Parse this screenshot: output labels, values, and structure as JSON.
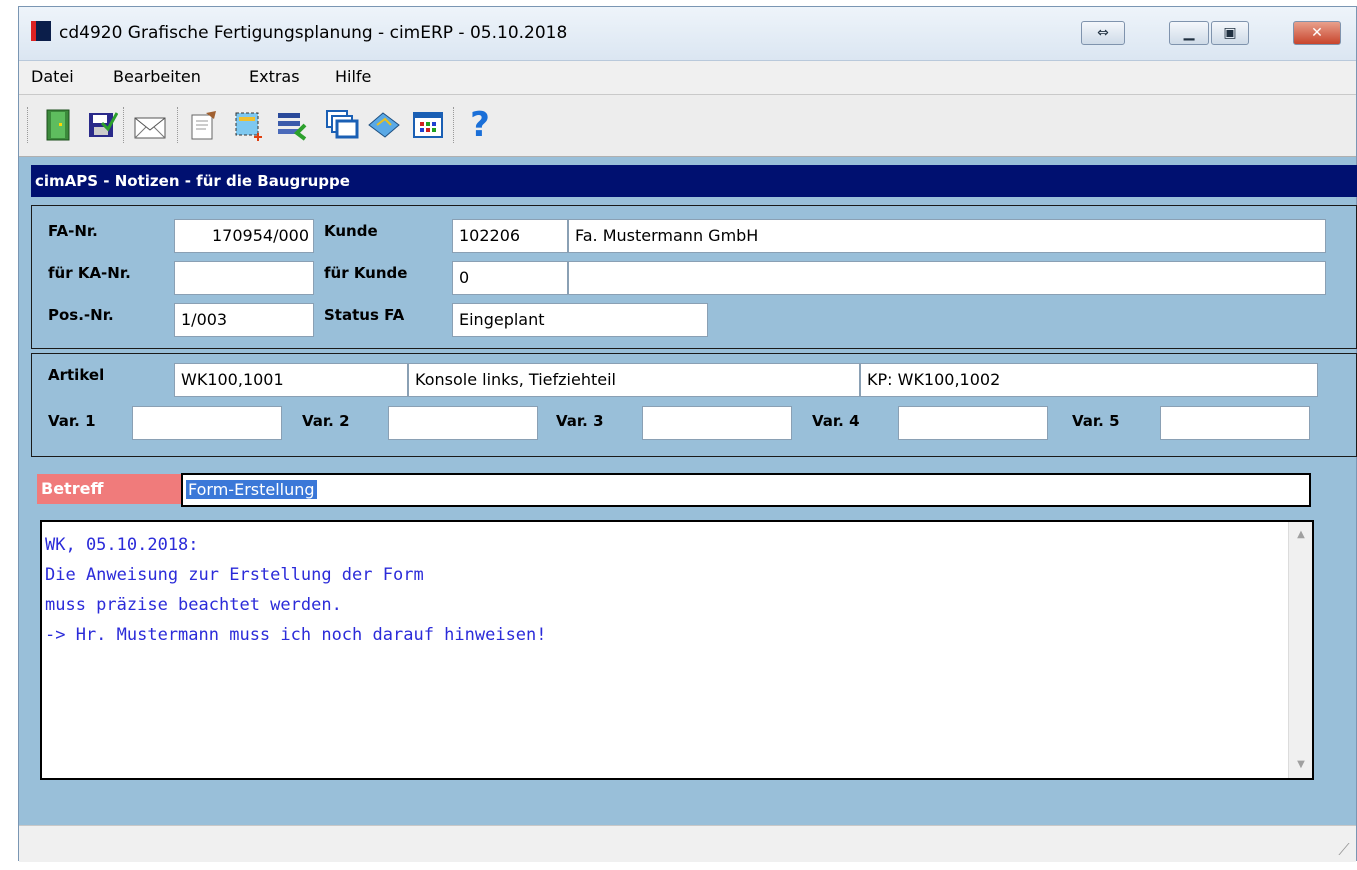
{
  "window": {
    "title": "cd4920 Grafische Fertigungsplanung - cimERP - 05.10.2018",
    "buttons": {
      "restore_size": "⇔",
      "minimize": "▁",
      "maximize": "▣",
      "close": "✕"
    }
  },
  "menu": {
    "items": [
      "Datei",
      "Bearbeiten",
      "Extras",
      "Hilfe"
    ]
  },
  "toolbar": {
    "icons": [
      "exit-door-icon",
      "save-icon",
      "mail-icon",
      "edit-document-icon",
      "select-area-icon",
      "list-import-icon",
      "windows-icon",
      "book-icon",
      "table-icon",
      "help-icon"
    ]
  },
  "header": {
    "title": "cimAPS - Notizen - für die Baugruppe"
  },
  "group1": {
    "fa_nr_label": "FA-Nr.",
    "fa_nr_value": "170954/000",
    "kunde_label": "Kunde",
    "kunde_nr": "102206",
    "kunde_name": "Fa. Mustermann GmbH",
    "ka_nr_label": "für KA-Nr.",
    "ka_nr_value": "",
    "fuer_kunde_label": "für Kunde",
    "fuer_kunde_nr": "0",
    "fuer_kunde_name": "",
    "pos_nr_label": "Pos.-Nr.",
    "pos_nr_value": "1/003",
    "status_label": "Status FA",
    "status_value": "Eingeplant"
  },
  "group2": {
    "artikel_label": "Artikel",
    "artikel_nr": "WK100,1001",
    "artikel_desc": "Konsole links, Tiefziehteil",
    "artikel_kp": "KP: WK100,1002",
    "var1_label": "Var. 1",
    "var1_value": "",
    "var2_label": "Var. 2",
    "var2_value": "",
    "var3_label": "Var. 3",
    "var3_value": "",
    "var4_label": "Var. 4",
    "var4_value": "",
    "var5_label": "Var. 5",
    "var5_value": ""
  },
  "betreff": {
    "label": "Betreff",
    "value": "Form-Erstellung"
  },
  "notes": {
    "text": "WK, 05.10.2018:\nDie Anweisung zur Erstellung der Form\nmuss präzise beachtet werden.\n-> Hr. Mustermann muss ich noch darauf hinweisen!"
  },
  "colors": {
    "header_bg": "#001070",
    "window_bg": "#99bfd9",
    "notes_text": "#2b2bd9",
    "betreff_label_bg": "#f07b7b",
    "selection": "#3b78d8"
  }
}
